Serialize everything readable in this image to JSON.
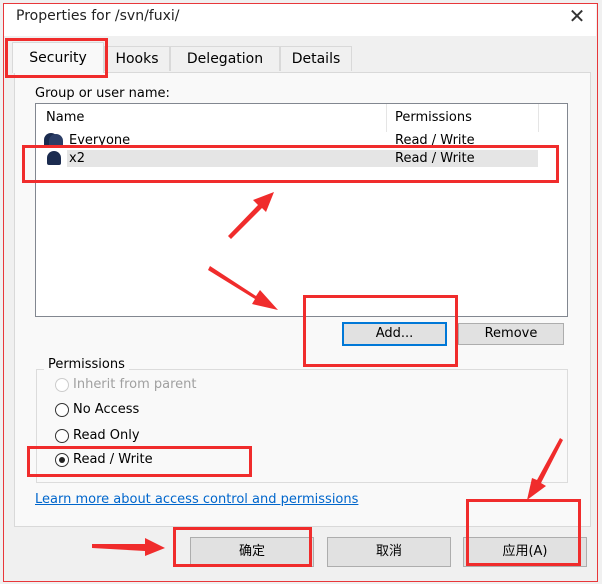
{
  "window": {
    "title": "Properties for /svn/fuxi/",
    "close_icon": "close-icon"
  },
  "tabs": [
    {
      "label": "Security",
      "selected": true
    },
    {
      "label": "Hooks"
    },
    {
      "label": "Delegation"
    },
    {
      "label": "Details"
    }
  ],
  "security": {
    "group_label": "Group or user name:",
    "columns": [
      "Name",
      "Permissions"
    ],
    "users": [
      {
        "name": "Everyone",
        "permission": "Read / Write",
        "icon": "group-icon"
      },
      {
        "name": "x2",
        "permission": "Read / Write",
        "icon": "user-icon",
        "selected": true
      }
    ],
    "add_label": "Add...",
    "remove_label": "Remove",
    "permissions_label": "Permissions",
    "options": [
      {
        "label": "Inherit from parent",
        "disabled": true
      },
      {
        "label": "No Access"
      },
      {
        "label": "Read Only"
      },
      {
        "label": "Read / Write",
        "checked": true
      }
    ],
    "link": "Learn more about access control and permissions"
  },
  "footer": {
    "ok": "确定",
    "cancel": "取消",
    "apply": "应用(A)"
  },
  "colors": {
    "annotation": "#f02c2c",
    "link": "#0066cc",
    "accent": "#0078d7"
  }
}
